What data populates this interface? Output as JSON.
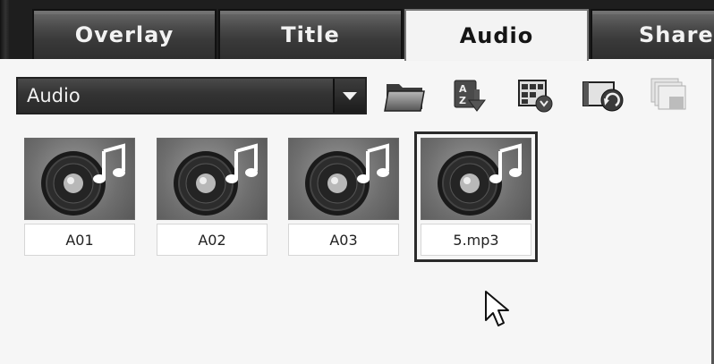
{
  "tabs": [
    {
      "label": "Overlay",
      "active": false
    },
    {
      "label": "Title",
      "active": false
    },
    {
      "label": "Audio",
      "active": true
    },
    {
      "label": "Share",
      "active": false
    }
  ],
  "toolbar": {
    "dropdown_value": "Audio",
    "icons": [
      "folder-icon",
      "sort-az-icon",
      "library-icon",
      "import-icon",
      "thumbnail-view-icon"
    ]
  },
  "clips": [
    {
      "label": "A01",
      "selected": false
    },
    {
      "label": "A02",
      "selected": false
    },
    {
      "label": "A03",
      "selected": false
    },
    {
      "label": "5.mp3",
      "selected": true
    }
  ],
  "colors": {
    "tab_bar": "#1e1e1e",
    "active_tab": "#f3f3f3",
    "panel_bg": "#f6f6f6",
    "dropdown_bg": "#333333"
  }
}
